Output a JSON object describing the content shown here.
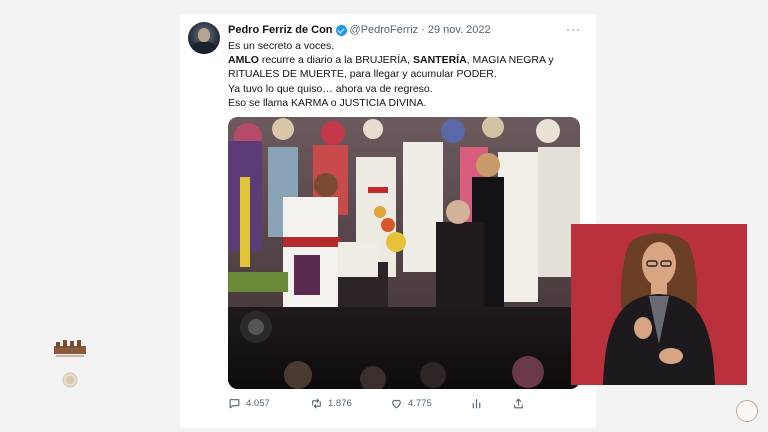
{
  "tweet": {
    "author_name": "Pedro Ferriz de Con",
    "handle": "@PedroFerriz",
    "separator": "·",
    "date": "29 nov. 2022",
    "more": "···",
    "lines": [
      {
        "parts": [
          {
            "t": "Es un secreto a voces.",
            "b": false
          }
        ]
      },
      {
        "parts": [
          {
            "t": "AMLO",
            "b": true
          },
          {
            "t": " recurre a diario a la BRUJERÍA, ",
            "b": false
          },
          {
            "t": "SANTERÍA",
            "b": true
          },
          {
            "t": ", MAGIA NEGRA y",
            "b": false
          }
        ]
      },
      {
        "parts": [
          {
            "t": "RITUALES DE MUERTE, para llegar y acumular PODER.",
            "b": false
          }
        ]
      },
      {
        "parts": [
          {
            "t": "Ya tuvo lo que quiso… ahora va de regreso.",
            "b": false
          }
        ]
      },
      {
        "parts": [
          {
            "t": "Eso se llama KARMA o JUSTICIA DIVINA.",
            "b": false
          }
        ]
      }
    ],
    "replies": "4.057",
    "retweets": "1.876",
    "likes": "4.775"
  },
  "icons": {
    "reply": "comment-icon",
    "retweet": "retweet-icon",
    "like": "heart-icon",
    "stats": "bar-chart-icon",
    "share": "share-icon",
    "verified": "verified-badge-icon",
    "more": "more-options-icon"
  },
  "colors": {
    "verified": "#1d9bf0",
    "muted": "#536471",
    "interpreter_bg": "#b8313d",
    "page_bg": "#f3f3f3"
  }
}
